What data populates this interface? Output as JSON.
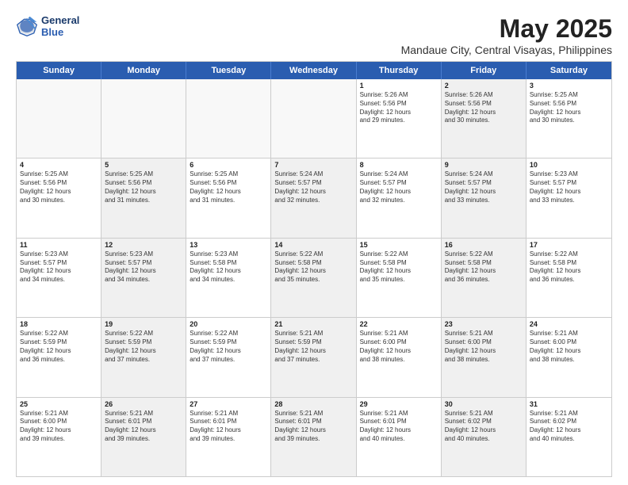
{
  "header": {
    "logo_line1": "General",
    "logo_line2": "Blue",
    "title": "May 2025",
    "subtitle": "Mandaue City, Central Visayas, Philippines"
  },
  "weekdays": [
    "Sunday",
    "Monday",
    "Tuesday",
    "Wednesday",
    "Thursday",
    "Friday",
    "Saturday"
  ],
  "rows": [
    [
      {
        "day": "",
        "text": "",
        "empty": true
      },
      {
        "day": "",
        "text": "",
        "empty": true
      },
      {
        "day": "",
        "text": "",
        "empty": true
      },
      {
        "day": "",
        "text": "",
        "empty": true
      },
      {
        "day": "1",
        "text": "Sunrise: 5:26 AM\nSunset: 5:56 PM\nDaylight: 12 hours\nand 29 minutes."
      },
      {
        "day": "2",
        "text": "Sunrise: 5:26 AM\nSunset: 5:56 PM\nDaylight: 12 hours\nand 30 minutes.",
        "shaded": true
      },
      {
        "day": "3",
        "text": "Sunrise: 5:25 AM\nSunset: 5:56 PM\nDaylight: 12 hours\nand 30 minutes."
      }
    ],
    [
      {
        "day": "4",
        "text": "Sunrise: 5:25 AM\nSunset: 5:56 PM\nDaylight: 12 hours\nand 30 minutes."
      },
      {
        "day": "5",
        "text": "Sunrise: 5:25 AM\nSunset: 5:56 PM\nDaylight: 12 hours\nand 31 minutes.",
        "shaded": true
      },
      {
        "day": "6",
        "text": "Sunrise: 5:25 AM\nSunset: 5:56 PM\nDaylight: 12 hours\nand 31 minutes."
      },
      {
        "day": "7",
        "text": "Sunrise: 5:24 AM\nSunset: 5:57 PM\nDaylight: 12 hours\nand 32 minutes.",
        "shaded": true
      },
      {
        "day": "8",
        "text": "Sunrise: 5:24 AM\nSunset: 5:57 PM\nDaylight: 12 hours\nand 32 minutes."
      },
      {
        "day": "9",
        "text": "Sunrise: 5:24 AM\nSunset: 5:57 PM\nDaylight: 12 hours\nand 33 minutes.",
        "shaded": true
      },
      {
        "day": "10",
        "text": "Sunrise: 5:23 AM\nSunset: 5:57 PM\nDaylight: 12 hours\nand 33 minutes."
      }
    ],
    [
      {
        "day": "11",
        "text": "Sunrise: 5:23 AM\nSunset: 5:57 PM\nDaylight: 12 hours\nand 34 minutes."
      },
      {
        "day": "12",
        "text": "Sunrise: 5:23 AM\nSunset: 5:57 PM\nDaylight: 12 hours\nand 34 minutes.",
        "shaded": true
      },
      {
        "day": "13",
        "text": "Sunrise: 5:23 AM\nSunset: 5:58 PM\nDaylight: 12 hours\nand 34 minutes."
      },
      {
        "day": "14",
        "text": "Sunrise: 5:22 AM\nSunset: 5:58 PM\nDaylight: 12 hours\nand 35 minutes.",
        "shaded": true
      },
      {
        "day": "15",
        "text": "Sunrise: 5:22 AM\nSunset: 5:58 PM\nDaylight: 12 hours\nand 35 minutes."
      },
      {
        "day": "16",
        "text": "Sunrise: 5:22 AM\nSunset: 5:58 PM\nDaylight: 12 hours\nand 36 minutes.",
        "shaded": true
      },
      {
        "day": "17",
        "text": "Sunrise: 5:22 AM\nSunset: 5:58 PM\nDaylight: 12 hours\nand 36 minutes."
      }
    ],
    [
      {
        "day": "18",
        "text": "Sunrise: 5:22 AM\nSunset: 5:59 PM\nDaylight: 12 hours\nand 36 minutes."
      },
      {
        "day": "19",
        "text": "Sunrise: 5:22 AM\nSunset: 5:59 PM\nDaylight: 12 hours\nand 37 minutes.",
        "shaded": true
      },
      {
        "day": "20",
        "text": "Sunrise: 5:22 AM\nSunset: 5:59 PM\nDaylight: 12 hours\nand 37 minutes."
      },
      {
        "day": "21",
        "text": "Sunrise: 5:21 AM\nSunset: 5:59 PM\nDaylight: 12 hours\nand 37 minutes.",
        "shaded": true
      },
      {
        "day": "22",
        "text": "Sunrise: 5:21 AM\nSunset: 6:00 PM\nDaylight: 12 hours\nand 38 minutes."
      },
      {
        "day": "23",
        "text": "Sunrise: 5:21 AM\nSunset: 6:00 PM\nDaylight: 12 hours\nand 38 minutes.",
        "shaded": true
      },
      {
        "day": "24",
        "text": "Sunrise: 5:21 AM\nSunset: 6:00 PM\nDaylight: 12 hours\nand 38 minutes."
      }
    ],
    [
      {
        "day": "25",
        "text": "Sunrise: 5:21 AM\nSunset: 6:00 PM\nDaylight: 12 hours\nand 39 minutes."
      },
      {
        "day": "26",
        "text": "Sunrise: 5:21 AM\nSunset: 6:01 PM\nDaylight: 12 hours\nand 39 minutes.",
        "shaded": true
      },
      {
        "day": "27",
        "text": "Sunrise: 5:21 AM\nSunset: 6:01 PM\nDaylight: 12 hours\nand 39 minutes."
      },
      {
        "day": "28",
        "text": "Sunrise: 5:21 AM\nSunset: 6:01 PM\nDaylight: 12 hours\nand 39 minutes.",
        "shaded": true
      },
      {
        "day": "29",
        "text": "Sunrise: 5:21 AM\nSunset: 6:01 PM\nDaylight: 12 hours\nand 40 minutes."
      },
      {
        "day": "30",
        "text": "Sunrise: 5:21 AM\nSunset: 6:02 PM\nDaylight: 12 hours\nand 40 minutes.",
        "shaded": true
      },
      {
        "day": "31",
        "text": "Sunrise: 5:21 AM\nSunset: 6:02 PM\nDaylight: 12 hours\nand 40 minutes."
      }
    ]
  ]
}
